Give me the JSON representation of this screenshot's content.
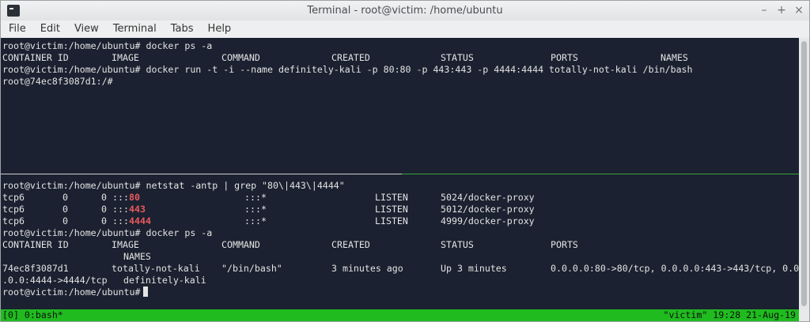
{
  "window": {
    "title": "Terminal - root@victim: /home/ubuntu"
  },
  "window_controls": {
    "minimize": "–",
    "maximize": "+",
    "close": "×"
  },
  "menu": [
    "File",
    "Edit",
    "View",
    "Terminal",
    "Tabs",
    "Help"
  ],
  "top_pane": {
    "prompt1": "root@victim:/home/ubuntu# docker ps -a",
    "headers": [
      "CONTAINER ID",
      "IMAGE",
      "COMMAND",
      "CREATED",
      "STATUS",
      "PORTS",
      "NAMES"
    ],
    "prompt2": "root@victim:/home/ubuntu# docker run -t -i --name definitely-kali -p 80:80 -p 443:443 -p 4444:4444 totally-not-kali /bin/bash",
    "container_prompt": "root@74ec8f3087d1:/#"
  },
  "bottom_pane": {
    "netstat_cmd": "root@victim:/home/ubuntu# netstat -antp | grep \"80\\|443\\|4444\"",
    "netstat_rows": [
      {
        "proto": "tcp6",
        "recv": "0",
        "send": "0",
        "local_prefix": ":::",
        "port": "80",
        "foreign": ":::*",
        "state": "LISTEN",
        "program": "5024/docker-proxy"
      },
      {
        "proto": "tcp6",
        "recv": "0",
        "send": "0",
        "local_prefix": ":::",
        "port": "443",
        "foreign": ":::*",
        "state": "LISTEN",
        "program": "5012/docker-proxy"
      },
      {
        "proto": "tcp6",
        "recv": "0",
        "send": "0",
        "local_prefix": ":::",
        "port": "4444",
        "foreign": ":::*",
        "state": "LISTEN",
        "program": "4999/docker-proxy"
      }
    ],
    "ps_cmd": "root@victim:/home/ubuntu# docker ps -a",
    "ps_headers": [
      "CONTAINER ID",
      "IMAGE",
      "COMMAND",
      "CREATED",
      "STATUS",
      "PORTS"
    ],
    "ps_names_header": "NAMES",
    "ps_row": {
      "id": "74ec8f3087d1",
      "image": "totally-not-kali",
      "command": "\"/bin/bash\"",
      "created": "3 minutes ago",
      "status": "Up 3 minutes",
      "ports": "0.0.0.0:80->80/tcp, 0.0.0.0:443->443/tcp, 0.0",
      "ports_wrap": ".0.0:4444->4444/tcp",
      "name": "definitely-kali"
    },
    "final_prompt": "root@victim:/home/ubuntu#"
  },
  "tmux_status": {
    "left": "[0] 0:bash*",
    "right": "\"victim\" 19:28 21-Aug-19"
  },
  "colors": {
    "terminal_bg": "#1b2130",
    "status_bar": "#1fbb1f",
    "port_highlight": "#e8595d"
  }
}
